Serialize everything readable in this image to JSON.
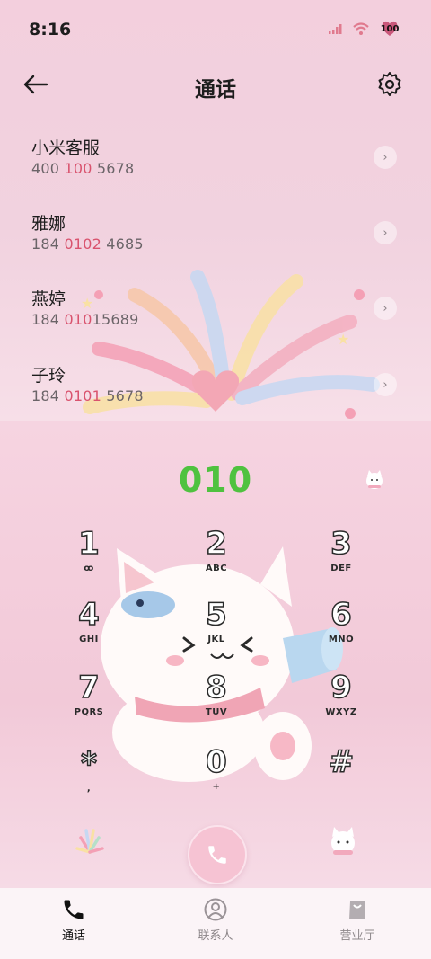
{
  "status_bar": {
    "time": "8:16",
    "battery": "100"
  },
  "header": {
    "title": "通话"
  },
  "calls": [
    {
      "name": "小米客服",
      "num_pre": "400 ",
      "num_hl": "100",
      "num_post": " 5678"
    },
    {
      "name": "雅娜",
      "num_pre": "184 ",
      "num_hl": "0102",
      "num_post": " 4685"
    },
    {
      "name": "燕婷",
      "num_pre": "184 ",
      "num_hl": "010",
      "num_post": "15689"
    },
    {
      "name": "子玲",
      "num_pre": "184 ",
      "num_hl": "0101",
      "num_post": " 5678"
    }
  ],
  "dialer": {
    "number": "010"
  },
  "keys": [
    {
      "digit": "1",
      "letters": "ꝏ"
    },
    {
      "digit": "2",
      "letters": "ABC"
    },
    {
      "digit": "3",
      "letters": "DEF"
    },
    {
      "digit": "4",
      "letters": "GHI"
    },
    {
      "digit": "5",
      "letters": "JKL"
    },
    {
      "digit": "6",
      "letters": "MNO"
    },
    {
      "digit": "7",
      "letters": "PQRS"
    },
    {
      "digit": "8",
      "letters": "TUV"
    },
    {
      "digit": "9",
      "letters": "WXYZ"
    },
    {
      "digit": "*",
      "letters": ","
    },
    {
      "digit": "0",
      "letters": "+"
    },
    {
      "digit": "#",
      "letters": ""
    }
  ],
  "nav": {
    "calls": "通话",
    "contacts": "联系人",
    "store": "营业厅"
  },
  "colors": {
    "accent": "#4fc23f",
    "highlight": "#d9536e",
    "call_button": "#f6c3d3"
  }
}
